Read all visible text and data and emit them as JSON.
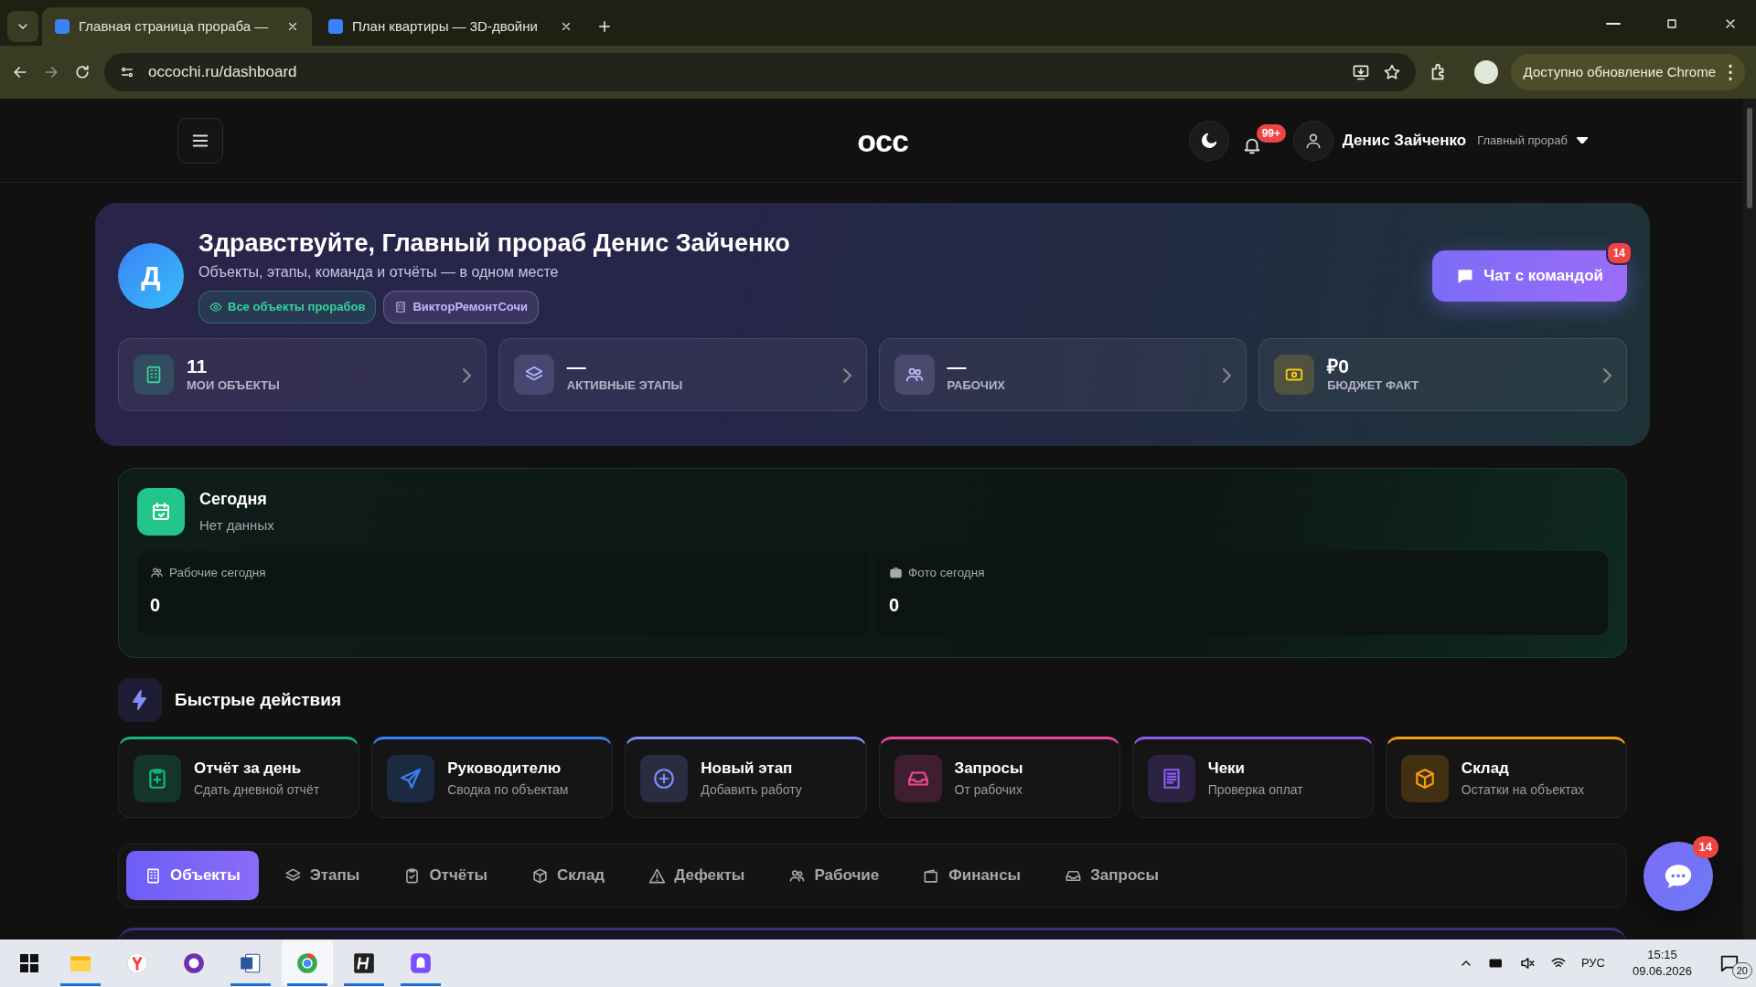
{
  "browser": {
    "tabs": [
      {
        "title": "Главная страница прораба —",
        "selected": true
      },
      {
        "title": "План квартиры — 3D-двойни",
        "selected": false
      }
    ],
    "address": "occochi.ru/dashboard",
    "update_button": "Доступно обновление Chrome"
  },
  "header": {
    "logo": "occ",
    "notification_badge": "99+",
    "user_name": "Денис Зайченко",
    "user_role": "Главный прораб"
  },
  "hero": {
    "avatar": "Д",
    "title": "Здравствуйте, Главный прораб Денис Зайченко",
    "subtitle": "Объекты, этапы, команда и отчёты — в одном месте",
    "chips": [
      {
        "label": "Все объекты прорабов",
        "color": "#34d399"
      },
      {
        "label": "ВикторРемонтСочи",
        "color": "#c4b5fd"
      }
    ],
    "chat_button": "Чат с командой",
    "chat_badge": "14",
    "stats": [
      {
        "value": "11",
        "label": "МОИ ОБЪЕКТЫ",
        "color": "#34d399"
      },
      {
        "value": "—",
        "label": "АКТИВНЫЕ ЭТАПЫ",
        "color": "#a5b4fc"
      },
      {
        "value": "—",
        "label": "РАБОЧИХ",
        "color": "#c4b5fd"
      },
      {
        "value": "₽0",
        "label": "БЮДЖЕТ ФАКТ",
        "color": "#facc15"
      }
    ]
  },
  "today": {
    "title": "Сегодня",
    "subtitle": "Нет данных",
    "cells": [
      {
        "label": "Рабочие сегодня",
        "value": "0"
      },
      {
        "label": "Фото сегодня",
        "value": "0"
      }
    ]
  },
  "quick_actions": {
    "title": "Быстрые действия",
    "items": [
      {
        "title": "Отчёт за день",
        "subtitle": "Сдать дневной отчёт",
        "color": "#10b981"
      },
      {
        "title": "Руководителю",
        "subtitle": "Сводка по объектам",
        "color": "#3b82f6"
      },
      {
        "title": "Новый этап",
        "subtitle": "Добавить работу",
        "color": "#818cf8"
      },
      {
        "title": "Запросы",
        "subtitle": "От рабочих",
        "color": "#ec4899"
      },
      {
        "title": "Чеки",
        "subtitle": "Проверка оплат",
        "color": "#8b5cf6"
      },
      {
        "title": "Склад",
        "subtitle": "Остатки на объектах",
        "color": "#f59e0b"
      }
    ]
  },
  "tabs": [
    {
      "label": "Объекты",
      "selected": true
    },
    {
      "label": "Этапы",
      "selected": false
    },
    {
      "label": "Отчёты",
      "selected": false
    },
    {
      "label": "Склад",
      "selected": false
    },
    {
      "label": "Дефекты",
      "selected": false
    },
    {
      "label": "Рабочие",
      "selected": false
    },
    {
      "label": "Финансы",
      "selected": false
    },
    {
      "label": "Запросы",
      "selected": false
    }
  ],
  "fab_badge": "14",
  "taskbar": {
    "apps": [
      {
        "open": true,
        "selected": false
      },
      {
        "open": false,
        "selected": false
      },
      {
        "open": false,
        "selected": false
      },
      {
        "open": true,
        "selected": false
      },
      {
        "open": true,
        "selected": true
      },
      {
        "open": true,
        "selected": false
      },
      {
        "open": true,
        "selected": false
      }
    ],
    "language": "РУС",
    "time": "15:15",
    "date": "09.06.2026",
    "notifications": "20"
  }
}
